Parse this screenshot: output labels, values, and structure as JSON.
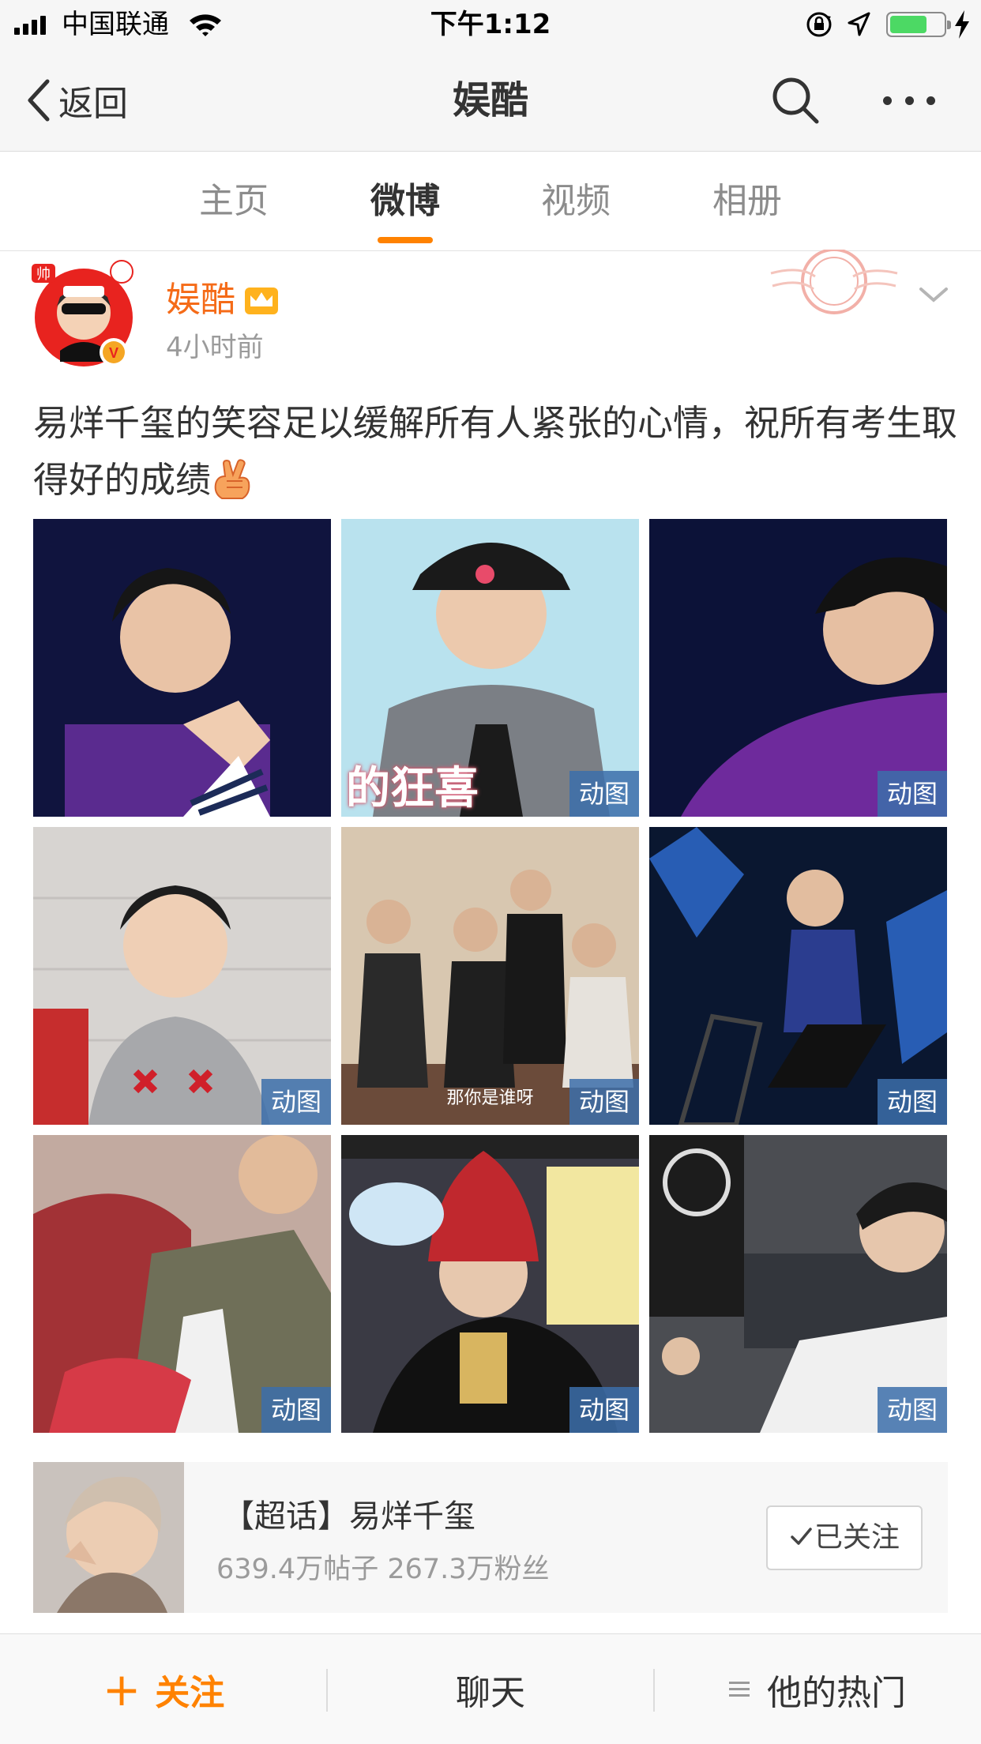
{
  "status_bar": {
    "carrier": "中国联通",
    "time": "下午1:12",
    "battery_level": 0.7
  },
  "nav": {
    "back_label": "返回",
    "title": "娱酷"
  },
  "tabs": [
    {
      "label": "主页",
      "active": false
    },
    {
      "label": "微博",
      "active": true
    },
    {
      "label": "视频",
      "active": false
    },
    {
      "label": "相册",
      "active": false
    }
  ],
  "post": {
    "author": "娱酷",
    "time": "4小时前",
    "text": "易烊千玺的笑容足以缓解所有人紧张的心情，祝所有考生取得好的成绩",
    "images": [
      {
        "badge": ""
      },
      {
        "badge": "动图",
        "overlay": "的狂喜"
      },
      {
        "badge": "动图"
      },
      {
        "badge": "动图"
      },
      {
        "badge": "动图",
        "caption": "那你是谁呀"
      },
      {
        "badge": "动图"
      },
      {
        "badge": "动图"
      },
      {
        "badge": "动图"
      },
      {
        "badge": "动图"
      }
    ]
  },
  "topic_card": {
    "title": "【超话】易烊千玺",
    "stats": "639.4万帖子  267.3万粉丝",
    "button_label": "已关注"
  },
  "bottom_bar": {
    "follow_label": "关注",
    "chat_label": "聊天",
    "hot_label": "他的热门"
  },
  "colors": {
    "accent": "#ff8200",
    "author": "#f56b18",
    "badge": "#3c6eaa"
  }
}
